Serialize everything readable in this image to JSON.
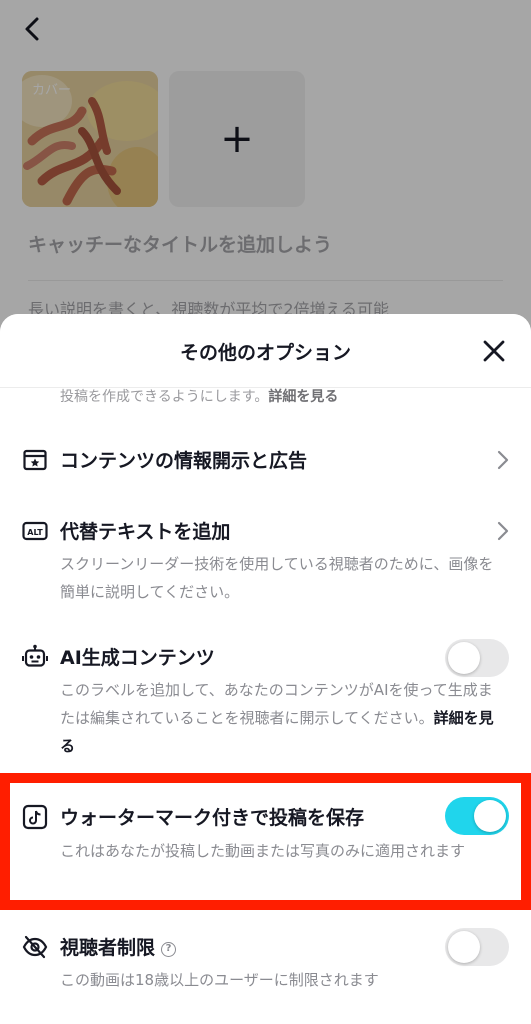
{
  "background": {
    "cover_label": "カバー",
    "add_symbol": "+",
    "title_placeholder": "キャッチーなタイトルを追加しよう",
    "description_placeholder": "長い説明を書くと、視聴数が平均で2倍増える可能"
  },
  "sheet": {
    "title": "その他のオプション",
    "cut_text": "投稿を作成できるようにします。",
    "cut_link": "詳細を見る",
    "rows": [
      {
        "title": "コンテンツの情報開示と広告",
        "icon": "disclosure-icon"
      },
      {
        "title": "代替テキストを追加",
        "icon": "alt-text-icon",
        "icon_text": "ALT",
        "description": "スクリーンリーダー技術を使用している視聴者のために、画像を簡単に説明してください。"
      },
      {
        "title": "AI生成コンテンツ",
        "icon": "robot-icon",
        "description": "このラベルを追加して、あなたのコンテンツがAIを使って生成または編集されていることを視聴者に開示してください。",
        "link": "詳細を見る",
        "toggle": false
      },
      {
        "title": "ウォーターマーク付きで投稿を保存",
        "icon": "tiktok-icon",
        "description": "これはあなたが投稿した動画または写真のみに適用されます",
        "toggle": true
      },
      {
        "title": "視聴者制限",
        "icon": "eye-off-icon",
        "help": "?",
        "description": "この動画は18歳以上のユーザーに制限されます",
        "toggle": false
      }
    ]
  },
  "colors": {
    "accent_toggle": "#20d5ec",
    "highlight_border": "#ff1e00",
    "text_primary": "#161823",
    "text_secondary": "#8a8b91"
  }
}
